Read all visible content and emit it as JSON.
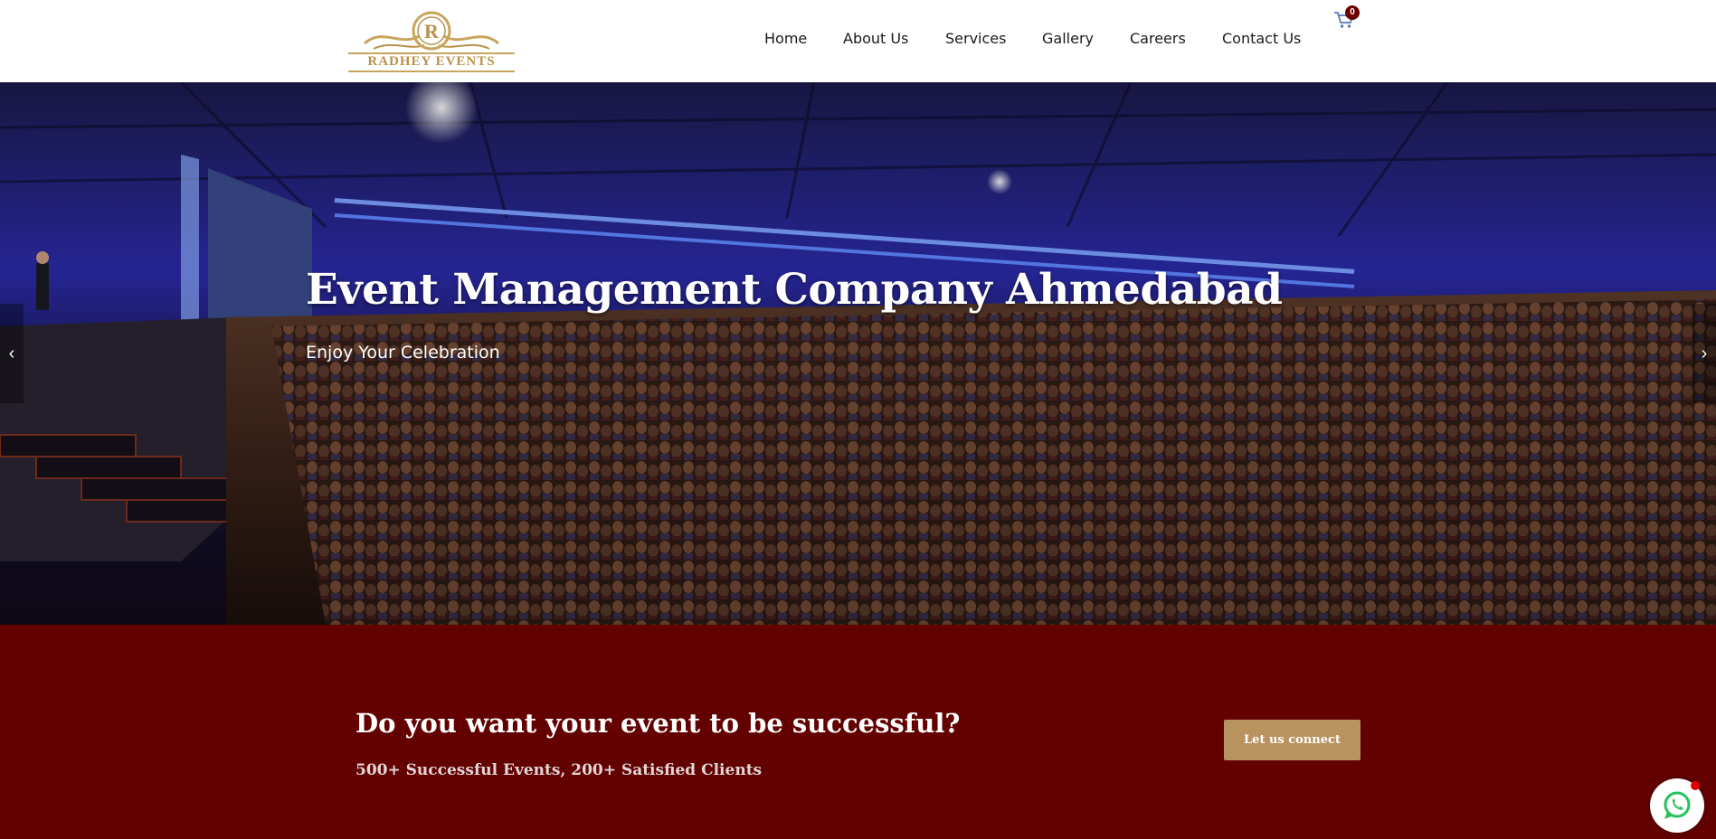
{
  "brand": {
    "logo_letter": "R",
    "logo_text": "RADHEY EVENTS",
    "gold": "#c9a45c"
  },
  "nav": {
    "items": [
      "Home",
      "About Us",
      "Services",
      "Gallery",
      "Careers",
      "Contact Us"
    ]
  },
  "cart": {
    "icon": "cart-icon",
    "count": "0"
  },
  "hero": {
    "title": "Event Management Company Ahmedabad",
    "subtitle": "Enjoy Your Celebration",
    "prev_icon": "chevron-left-icon",
    "next_icon": "chevron-right-icon"
  },
  "cta": {
    "title": "Do you want your event to be successful?",
    "subtitle": "500+ Successful Events, 200+ Satisfied Clients",
    "button_label": "Let us connect",
    "bg_color": "#630000",
    "button_color": "#b8935f"
  },
  "whatsapp": {
    "icon": "whatsapp-icon"
  }
}
